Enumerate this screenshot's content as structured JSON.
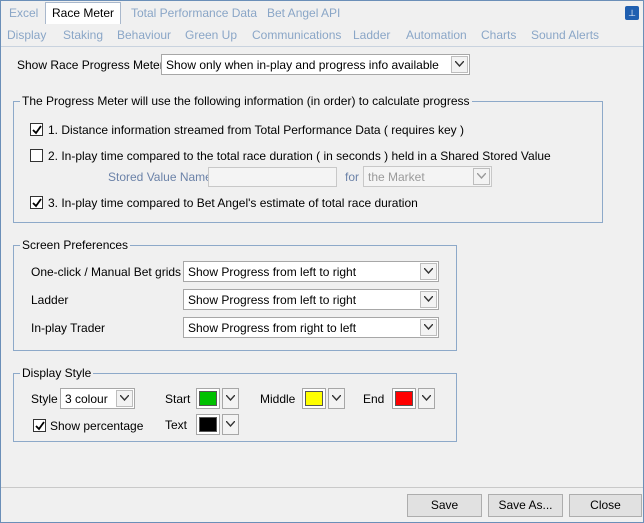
{
  "tabs_row1": [
    {
      "label": "Excel",
      "active": false
    },
    {
      "label": "Race Meter",
      "active": true
    },
    {
      "label": "Total Performance Data",
      "active": false
    },
    {
      "label": "Bet Angel API",
      "active": false
    }
  ],
  "tabs_row2": [
    {
      "label": "Display"
    },
    {
      "label": "Staking"
    },
    {
      "label": "Behaviour"
    },
    {
      "label": "Green Up"
    },
    {
      "label": "Communications"
    },
    {
      "label": "Ladder"
    },
    {
      "label": "Automation"
    },
    {
      "label": "Charts"
    },
    {
      "label": "Sound Alerts"
    }
  ],
  "pin_glyph": "⊥",
  "show_meter": {
    "label": "Show Race Progress Meter",
    "value": "Show only when in-play and progress info available"
  },
  "progress_group": {
    "title": "The Progress Meter will use the following information (in order) to calculate progress",
    "option1": {
      "label": "1. Distance information streamed from Total Performance Data ( requires key )",
      "checked": true
    },
    "option2": {
      "label": "2. In-play time compared to the total race duration ( in seconds ) held in a Shared Stored Value",
      "checked": false
    },
    "stored_value_label": "Stored Value Name",
    "stored_value": "",
    "for_label": "for",
    "for_value": "the Market",
    "option3": {
      "label": "3. In-play time compared to Bet Angel's estimate of total race duration",
      "checked": true
    }
  },
  "screen_prefs": {
    "title": "Screen Preferences",
    "rows": [
      {
        "label": "One-click / Manual Bet grids",
        "value": "Show Progress from left to right"
      },
      {
        "label": "Ladder",
        "value": "Show Progress from left to right"
      },
      {
        "label": "In-play Trader",
        "value": "Show Progress from right to left"
      }
    ]
  },
  "display_style": {
    "title": "Display Style",
    "style_label": "Style",
    "style_value": "3 colour",
    "start_label": "Start",
    "start_color": "#00c000",
    "middle_label": "Middle",
    "middle_color": "#ffff00",
    "end_label": "End",
    "end_color": "#ff0000",
    "show_percentage": {
      "label": "Show percentage",
      "checked": true
    },
    "text_label": "Text",
    "text_color": "#000000"
  },
  "buttons": {
    "save": "Save",
    "save_as": "Save As...",
    "close": "Close"
  }
}
